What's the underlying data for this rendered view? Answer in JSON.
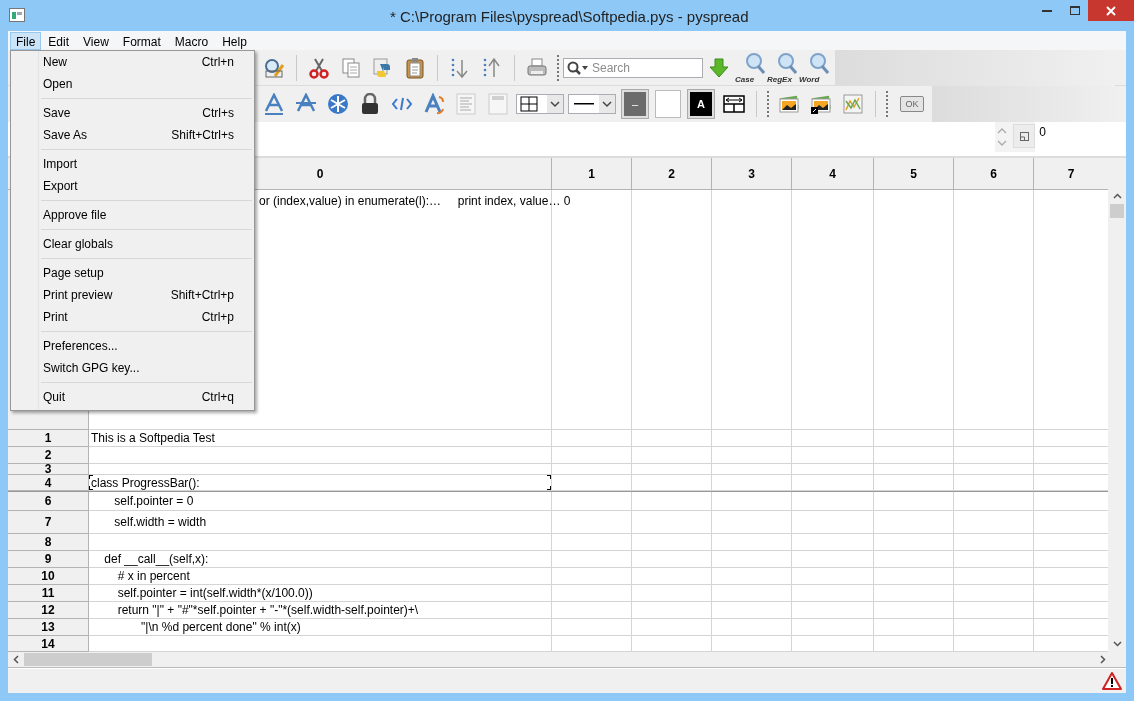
{
  "window": {
    "title": "* C:\\Program Files\\pyspread\\Softpedia.pys - pyspread"
  },
  "menu_bar": [
    {
      "label": "File",
      "selected": true
    },
    {
      "label": "Edit",
      "selected": false
    },
    {
      "label": "View",
      "selected": false
    },
    {
      "label": "Format",
      "selected": false
    },
    {
      "label": "Macro",
      "selected": false
    },
    {
      "label": "Help",
      "selected": false
    }
  ],
  "file_menu": [
    [
      {
        "label": "New",
        "shortcut": "Ctrl+n"
      },
      {
        "label": "Open"
      }
    ],
    [
      {
        "label": "Save",
        "shortcut": "Ctrl+s"
      },
      {
        "label": "Save As",
        "shortcut": "Shift+Ctrl+s"
      }
    ],
    [
      {
        "label": "Import"
      },
      {
        "label": "Export"
      }
    ],
    [
      {
        "label": "Approve file"
      }
    ],
    [
      {
        "label": "Clear globals"
      }
    ],
    [
      {
        "label": "Page setup"
      },
      {
        "label": "Print preview",
        "shortcut": "Shift+Ctrl+p"
      },
      {
        "label": "Print",
        "shortcut": "Ctrl+p"
      }
    ],
    [
      {
        "label": "Preferences..."
      },
      {
        "label": "Switch GPG key..."
      }
    ],
    [
      {
        "label": "Quit",
        "shortcut": "Ctrl+q"
      }
    ]
  ],
  "search": {
    "placeholder": "Search",
    "options": [
      "Case",
      "RegEx",
      "Word"
    ]
  },
  "format_toolbar": {
    "line_color_label": "–",
    "text_color_label": "A",
    "ok_label": "OK"
  },
  "entry_line": {
    "table_number": "0"
  },
  "grid": {
    "columns": [
      "0",
      "1",
      "2",
      "3",
      "4",
      "5",
      "6",
      "7"
    ],
    "rows": [
      {
        "text": "or (index,value) in enumerate(l):…     print index, value… 0",
        "selected": false
      },
      {
        "header": "1",
        "text": "This is a Softpedia Test",
        "selected": false
      },
      {
        "header": "2",
        "selected": false
      },
      {
        "header": "3",
        "selected": false
      },
      {
        "header": "4",
        "text": "class ProgressBar():",
        "selected": true
      },
      {
        "header": "6",
        "text": "       self.pointer = 0",
        "selected": false
      },
      {
        "header": "7",
        "text": "       self.width = width",
        "selected": false
      },
      {
        "header": "8",
        "selected": false
      },
      {
        "header": "9",
        "text": "    def __call__(self,x):",
        "selected": false
      },
      {
        "header": "10",
        "text": "        # x in percent",
        "selected": false
      },
      {
        "header": "11",
        "text": "        self.pointer = int(self.width*(x/100.0))",
        "selected": false
      },
      {
        "header": "12",
        "text": "        return \"|\" + \"#\"*self.pointer + \"-\"*(self.width-self.pointer)+\\",
        "selected": false
      },
      {
        "header": "13",
        "text": "               \"|\\n %d percent done\" % int(x)",
        "selected": false
      },
      {
        "header": "14",
        "selected": false
      }
    ]
  }
}
